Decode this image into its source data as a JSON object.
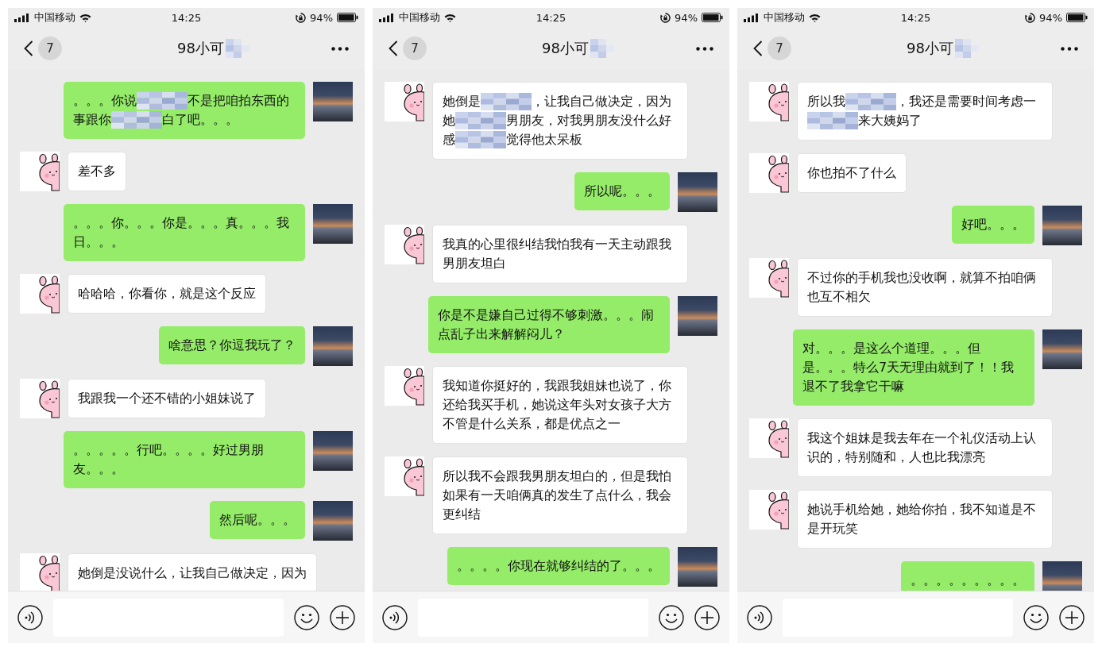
{
  "screens": [
    {
      "status_bar": {
        "carrier": "中国移动",
        "time": "14:25",
        "battery": "94%"
      },
      "header": {
        "unread_badge": "7",
        "title": "98小可"
      },
      "messages": [
        {
          "kind": "sent",
          "parts": [
            {
              "kind": "text",
              "text": "。。。你说"
            },
            {
              "kind": "pixelated"
            },
            {
              "kind": "text",
              "text": "不是把咱拍东西的"
            },
            {
              "kind": "text",
              "text": "事跟你"
            },
            {
              "kind": "pixelated"
            },
            {
              "kind": "text",
              "text": "白了吧。。。"
            }
          ]
        },
        {
          "kind": "received",
          "parts": [
            {
              "kind": "text",
              "text": "差不多"
            }
          ]
        },
        {
          "kind": "sent",
          "parts": [
            {
              "kind": "text",
              "text": "。。。你。。。你是。。。真。。。我日。。。"
            }
          ]
        },
        {
          "kind": "received",
          "parts": [
            {
              "kind": "text",
              "text": "哈哈哈，你看你，就是这个反应"
            }
          ]
        },
        {
          "kind": "sent",
          "parts": [
            {
              "kind": "text",
              "text": "啥意思？你逗我玩了？"
            }
          ]
        },
        {
          "kind": "received",
          "parts": [
            {
              "kind": "text",
              "text": "我跟我一个还不错的小姐妹说了"
            }
          ]
        },
        {
          "kind": "sent",
          "parts": [
            {
              "kind": "text",
              "text": "。。。。。行吧。。。。好过男朋友。。。"
            }
          ]
        },
        {
          "kind": "sent",
          "parts": [
            {
              "kind": "text",
              "text": "然后呢。。。"
            }
          ]
        },
        {
          "kind": "received",
          "parts": [
            {
              "kind": "text",
              "text": "她倒是没说什么，让我自己做决定，因为"
            }
          ]
        }
      ]
    },
    {
      "status_bar": {
        "carrier": "中国移动",
        "time": "14:25",
        "battery": "94%"
      },
      "header": {
        "unread_badge": "7",
        "title": "98小可"
      },
      "messages": [
        {
          "kind": "received",
          "parts": [
            {
              "kind": "text",
              "text": "她倒是"
            },
            {
              "kind": "pixelated"
            },
            {
              "kind": "text",
              "text": "，让我自己做决定，因为"
            },
            {
              "kind": "text",
              "text": "她"
            },
            {
              "kind": "pixelated"
            },
            {
              "kind": "text",
              "text": "男朋友，对我男朋友没什么好"
            },
            {
              "kind": "text",
              "text": "感"
            },
            {
              "kind": "pixelated"
            },
            {
              "kind": "text",
              "text": "觉得他太呆板"
            }
          ]
        },
        {
          "kind": "sent",
          "parts": [
            {
              "kind": "text",
              "text": "所以呢。。。"
            }
          ]
        },
        {
          "kind": "received",
          "parts": [
            {
              "kind": "text",
              "text": "我真的心里很纠结我怕我有一天主动跟我男朋友坦白"
            }
          ]
        },
        {
          "kind": "sent",
          "parts": [
            {
              "kind": "text",
              "text": "你是不是嫌自己过得不够刺激。。。闹点乱子出来解解闷儿？"
            }
          ]
        },
        {
          "kind": "received",
          "parts": [
            {
              "kind": "text",
              "text": "我知道你挺好的，我跟我姐妹也说了，你还给我买手机，她说这年头对女孩子大方不管是什么关系，都是优点之一"
            }
          ]
        },
        {
          "kind": "received",
          "parts": [
            {
              "kind": "text",
              "text": "所以我不会跟我男朋友坦白的，但是我怕如果有一天咱俩真的发生了点什么，我会更纠结"
            }
          ]
        },
        {
          "kind": "sent",
          "parts": [
            {
              "kind": "text",
              "text": "。。。。你现在就够纠结的了。。。"
            }
          ]
        }
      ]
    },
    {
      "status_bar": {
        "carrier": "中国移动",
        "time": "14:25",
        "battery": "94%"
      },
      "header": {
        "unread_badge": "7",
        "title": "98小可"
      },
      "messages": [
        {
          "kind": "received",
          "parts": [
            {
              "kind": "text",
              "text": "所以我"
            },
            {
              "kind": "pixelated"
            },
            {
              "kind": "text",
              "text": "，我还是需要时间考虑"
            },
            {
              "kind": "text",
              "text": "一"
            },
            {
              "kind": "pixelated"
            },
            {
              "kind": "text",
              "text": "来大姨妈了"
            }
          ]
        },
        {
          "kind": "received",
          "parts": [
            {
              "kind": "text",
              "text": "你也拍不了什么"
            }
          ]
        },
        {
          "kind": "sent",
          "parts": [
            {
              "kind": "text",
              "text": "好吧。。。"
            }
          ]
        },
        {
          "kind": "received",
          "parts": [
            {
              "kind": "text",
              "text": "不过你的手机我也没收啊，就算不拍咱俩也互不相欠"
            }
          ]
        },
        {
          "kind": "sent",
          "parts": [
            {
              "kind": "line",
              "text": "对。。。是这么个道理。。。但"
            },
            {
              "kind": "line",
              "text": "是。。。特么7天无理由就到了！！我退不了我拿它干嘛"
            }
          ]
        },
        {
          "kind": "received",
          "parts": [
            {
              "kind": "text",
              "text": "我这个姐妹是我去年在一个礼仪活动上认识的，特别随和，人也比我漂亮"
            }
          ]
        },
        {
          "kind": "received",
          "parts": [
            {
              "kind": "text",
              "text": "她说手机给她，她给你拍，我不知道是不是开玩笑"
            }
          ]
        },
        {
          "kind": "sent",
          "parts": [
            {
              "kind": "text",
              "text": "。。。。。。。。。"
            }
          ]
        }
      ]
    }
  ]
}
